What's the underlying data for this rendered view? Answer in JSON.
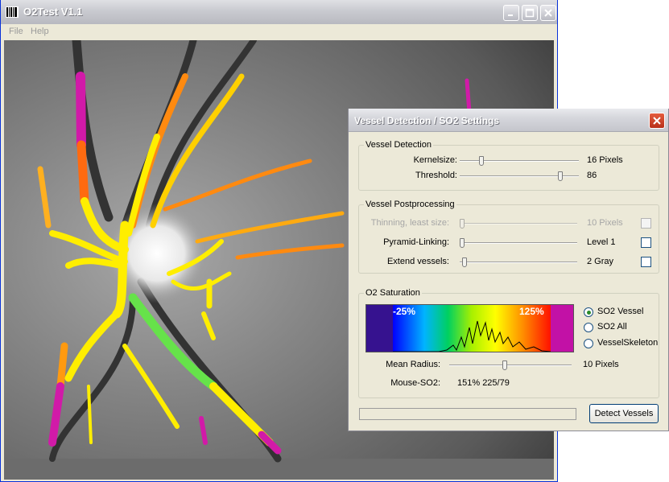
{
  "main_window": {
    "title": "O2Test V1.1",
    "menu": [
      "File",
      "Help"
    ]
  },
  "dialog": {
    "title": "Vessel Detection / SO2 Settings",
    "vessel_detection": {
      "title": "Vessel Detection",
      "kernelsize": {
        "label": "Kernelsize:",
        "value": "16 Pixels",
        "level": 0.17
      },
      "threshold": {
        "label": "Threshold:",
        "value": "86",
        "level": 0.86
      }
    },
    "vessel_postprocessing": {
      "title": "Vessel Postprocessing",
      "thinning": {
        "label": "Thinning, least size:",
        "value": "10 Pixels",
        "level": 0.0,
        "checked": false,
        "enabled": false
      },
      "pyramid": {
        "label": "Pyramid-Linking:",
        "value": "Level 1",
        "level": 0.0,
        "checked": false
      },
      "extend": {
        "label": "Extend vessels:",
        "value": "2 Gray",
        "level": 0.02,
        "checked": false
      }
    },
    "so2_saturation": {
      "title": "O2 Saturation",
      "spectrum_min_label": "-25%",
      "spectrum_max_label": "125%",
      "radio_options": [
        {
          "label": "SO2 Vessel",
          "selected": true
        },
        {
          "label": "SO2 All",
          "selected": false
        },
        {
          "label": "VesselSkeleton",
          "selected": false
        }
      ],
      "mean_radius": {
        "label": "Mean Radius:",
        "value": "10 Pixels",
        "level": 0.45
      },
      "mouse_so2": {
        "label": "Mouse-SO2:",
        "value": "151% 225/79"
      }
    },
    "progress": 0,
    "detect_button": "Detect Vessels"
  },
  "colors": {
    "dialog_bg": "#ece9d8",
    "vessel_yellow": "#ffee00",
    "vessel_magenta": "#d11aa8"
  }
}
